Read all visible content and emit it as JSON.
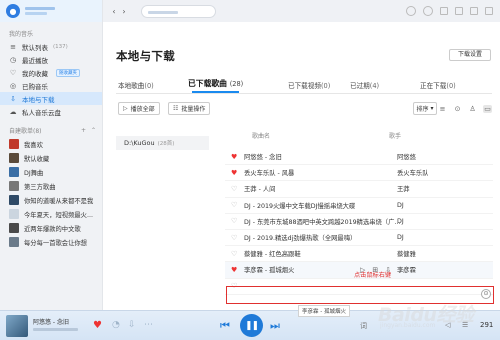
{
  "sidebar": {
    "my_music_label": "我的音乐",
    "items": [
      {
        "label": "默认列表",
        "count": "(137)",
        "icon": "list-icon"
      },
      {
        "label": "最近播放",
        "icon": "clock-icon"
      },
      {
        "label": "我的收藏",
        "tag": "随收藏夹",
        "icon": "heart-outline-icon"
      },
      {
        "label": "已购音乐",
        "icon": "purchased-icon"
      },
      {
        "label": "本地与下载",
        "icon": "download-icon",
        "active": true
      },
      {
        "label": "私人音乐云盘",
        "icon": "cloud-icon"
      }
    ],
    "created_label": "自建歌单",
    "created_count": "(8)",
    "playlists": [
      {
        "label": "我喜欢",
        "color": "#c0392b"
      },
      {
        "label": "默认收藏",
        "color": "#5a4a3a"
      },
      {
        "label": "DJ舞曲",
        "color": "#3a6ea5"
      },
      {
        "label": "第三方歌曲",
        "color": "#777777"
      },
      {
        "label": "你知的道暖从来都不是我",
        "color": "#2f4a66"
      },
      {
        "label": "今年夏天，短视频最火...",
        "color": "#cbd5df"
      },
      {
        "label": "近两年爆款的中文歌",
        "color": "#4a4a4a"
      },
      {
        "label": "每分每一首歌会让你想",
        "color": "#6b7b8a"
      }
    ]
  },
  "main": {
    "title": "本地与下载",
    "download_settings": "下载设置",
    "tabs": [
      {
        "label": "本地歌曲",
        "count": "(0)"
      },
      {
        "label": "已下载歌曲",
        "count": "(28)",
        "active": true
      },
      {
        "label": "已下载视频",
        "count": "(0)"
      },
      {
        "label": "已过期",
        "count": "(4)"
      },
      {
        "label": "正在下载",
        "count": "(0)"
      }
    ],
    "toolbar": {
      "play_all": "播放全部",
      "batch": "批量操作",
      "sort": "排序"
    },
    "folder": {
      "path": "D:\\KuGou",
      "count": "(28首)"
    },
    "columns": {
      "song": "歌曲名",
      "artist": "歌手"
    },
    "rows": [
      {
        "song": "阿悠悠 - 念旧",
        "artist": "阿悠悠",
        "fav": true
      },
      {
        "song": "丢火车乐队 - 风暴",
        "artist": "丢火车乐队",
        "fav": true
      },
      {
        "song": "王莽 - 人间",
        "artist": "王莽",
        "fav": false
      },
      {
        "song": "DJ - 2019火爆中文车载DJ慢摇串烧大碟",
        "artist": "DJ",
        "fav": false
      },
      {
        "song": "DJ - 东莞市东城88酒吧中英文跨越2019精选串烧（广...",
        "artist": "DJ",
        "fav": false
      },
      {
        "song": "DJ - 2019.精选dj劲爆热歌（全网最嗨）",
        "artist": "DJ",
        "fav": false
      },
      {
        "song": "蔡健雅 - 红色高跟鞋",
        "artist": "蔡健雅",
        "fav": false
      },
      {
        "song": "李彦霖 - 孤城烟火",
        "artist": "李彦霖",
        "fav": true,
        "hover": true
      },
      {
        "song": "",
        "artist": "",
        "fav": false
      }
    ],
    "annotation": "点击鼠标右键",
    "tooltip": "李彦霖 - 孤城烟火"
  },
  "player": {
    "title": "阿悠悠 - 念旧",
    "count": "291"
  },
  "watermark": {
    "text": "Baidu经验",
    "url": "jingyan.baidu.com"
  }
}
